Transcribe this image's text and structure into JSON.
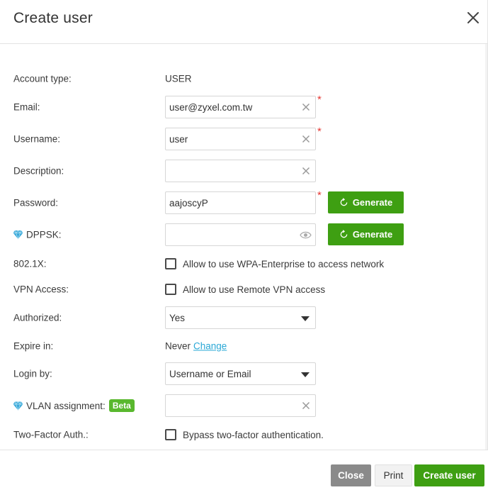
{
  "dialog": {
    "title": "Create user"
  },
  "form": {
    "account_type": {
      "label": "Account type:",
      "value": "USER"
    },
    "email": {
      "label": "Email:",
      "value": "user@zyxel.com.tw",
      "required_mark": "*"
    },
    "username": {
      "label": "Username:",
      "value": "user",
      "required_mark": "*"
    },
    "description": {
      "label": "Description:",
      "value": ""
    },
    "password": {
      "label": "Password:",
      "value": "aajoscyP",
      "required_mark": "*",
      "generate_label": "Generate"
    },
    "dppsk": {
      "label": "DPPSK:",
      "value": "",
      "generate_label": "Generate"
    },
    "dot1x": {
      "label": "802.1X:",
      "checkbox_label": "Allow to use WPA-Enterprise to access network",
      "checked": false
    },
    "vpn_access": {
      "label": "VPN Access:",
      "checkbox_label": "Allow to use Remote VPN access",
      "checked": false
    },
    "authorized": {
      "label": "Authorized:",
      "selected": "Yes"
    },
    "expire_in": {
      "label": "Expire in:",
      "value": "Never",
      "link": "Change"
    },
    "login_by": {
      "label": "Login by:",
      "selected": "Username or Email"
    },
    "vlan_assignment": {
      "label": "VLAN assignment:",
      "badge": "Beta",
      "value": ""
    },
    "two_factor": {
      "label": "Two-Factor Auth.:",
      "checkbox_label": "Bypass two-factor authentication.",
      "checked": false
    }
  },
  "footer": {
    "close_label": "Close",
    "print_label": "Print",
    "create_label": "Create user"
  },
  "colors": {
    "primary_green": "#3e9f12",
    "beta_green": "#59b82e",
    "link_blue": "#2aa8d6",
    "required_red": "#e53935",
    "gem_blue": "#3aa9d9",
    "close_gray": "#8a8a8a"
  },
  "icons": {
    "close": "close-icon",
    "clear": "clear-icon",
    "eye": "eye-icon",
    "refresh": "refresh-icon",
    "gem": "diamond-icon",
    "dropdown": "chevron-down-icon"
  }
}
